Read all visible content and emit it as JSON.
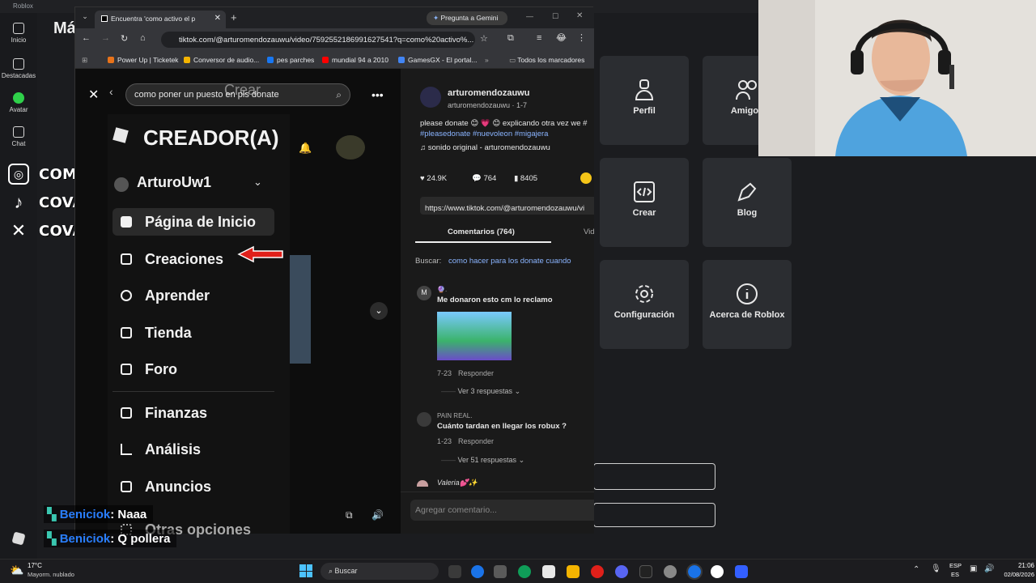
{
  "roblox": {
    "window_title": "Roblox",
    "nav": [
      {
        "label": "Inicio",
        "icon": "home-icon"
      },
      {
        "label": "Destacadas",
        "icon": "charts-icon"
      },
      {
        "label": "Avatar",
        "icon": "avatar-icon"
      },
      {
        "label": "Chat",
        "icon": "chat-icon"
      }
    ],
    "heading_partial": "Má",
    "tiles": [
      {
        "label": "Perfil",
        "icon": "profile-icon"
      },
      {
        "label": "Amigos",
        "icon": "friends-icon"
      },
      {
        "label": "Crear",
        "icon": "code-icon"
      },
      {
        "label": "Blog",
        "icon": "pen-icon"
      },
      {
        "label": "Configuración",
        "icon": "gear-icon"
      },
      {
        "label": "Acerca de Roblox",
        "icon": "info-icon"
      }
    ]
  },
  "socials": [
    {
      "icon": "instagram-icon",
      "handle": "COMINELLINACHO"
    },
    {
      "icon": "tiktok-icon",
      "handle": "COVAZBR"
    },
    {
      "icon": "x-icon",
      "handle": "COVAZBR"
    }
  ],
  "browser": {
    "tab_title": "Encuentra 'como activo el p",
    "gemini_label": "Pregunta a Gemini",
    "url": "tiktok.com/@arturomendozauwu/video/7592552186991627541?q=como%20activo%...",
    "bookmarks": [
      {
        "label": "Power Up | Ticketek",
        "color": "#e8731a"
      },
      {
        "label": "Conversor de audio...",
        "color": "#f4b400"
      },
      {
        "label": "pes parches",
        "color": "#1877f2"
      },
      {
        "label": "mundial 94 a 2010",
        "color": "#ff0000"
      },
      {
        "label": "GamesGX - El portal...",
        "color": "#4285f4"
      }
    ],
    "bookmarks_folder": "Todos los marcadores"
  },
  "video": {
    "search_query": "como poner un puesto en pls donate",
    "overlay_word": "Crear",
    "creator_title": "CREADOR(A)",
    "account": "ArturoUw1",
    "menu": [
      {
        "label": "Página de Inicio",
        "icon": "home-icon"
      },
      {
        "label": "Creaciones",
        "icon": "folder-icon"
      },
      {
        "label": "Aprender",
        "icon": "learn-icon"
      },
      {
        "label": "Tienda",
        "icon": "store-icon"
      },
      {
        "label": "Foro",
        "icon": "forum-icon"
      },
      {
        "label": "Finanzas",
        "icon": "wallet-icon"
      },
      {
        "label": "Análisis",
        "icon": "analytics-icon"
      },
      {
        "label": "Anuncios",
        "icon": "megaphone-icon"
      },
      {
        "label": "Otras opciones",
        "icon": "grid-icon"
      }
    ]
  },
  "tiktok": {
    "author": "arturomendozauwu",
    "author_sub": "arturomendozauwu · 1-7",
    "caption": "please donate 😊 💗 😊 explicando otra vez we #",
    "hashtags": "#pleasedonate #nuevoleon #migajera",
    "sound": "sonido original - arturomendozauwu",
    "likes": "24.9K",
    "comments_count": "764",
    "saves": "8405",
    "link": "https://www.tiktok.com/@arturomendozauwu/vi",
    "tab_comments": "Comentarios (764)",
    "tab_other": "Vid",
    "search_label": "Buscar:",
    "search_link": "como hacer para los donate cuando",
    "comments": [
      {
        "user": "🔮.",
        "text": "Me donaron esto cm lo reclamo",
        "date": "7-23",
        "reply": "Responder",
        "more": "Ver 3 respuestas"
      },
      {
        "user": "PAIN REAL.",
        "text": "Cuánto tardan en llegar los robux ?",
        "date": "1-23",
        "reply": "Responder",
        "more": "Ver 51 respuestas"
      },
      {
        "user": "Valeria💕✨",
        "text": "",
        "date": "",
        "reply": "",
        "more": ""
      }
    ],
    "add_comment": "Agregar comentario..."
  },
  "chat": [
    {
      "user": "Beniciok",
      "msg": ": Naaa"
    },
    {
      "user": "Beniciok",
      "msg": ": Q pollera"
    }
  ],
  "taskbar": {
    "weather_temp": "17°C",
    "weather_desc": "Mayorm. nublado",
    "search": "Buscar",
    "lang1": "ESP",
    "lang2": "ES",
    "time": "21:06",
    "date": "02/08/2026"
  },
  "colors": {
    "chat_user": "#2a7fff",
    "accent_link": "#4aa3ff",
    "arrow_red": "#e0201a"
  }
}
